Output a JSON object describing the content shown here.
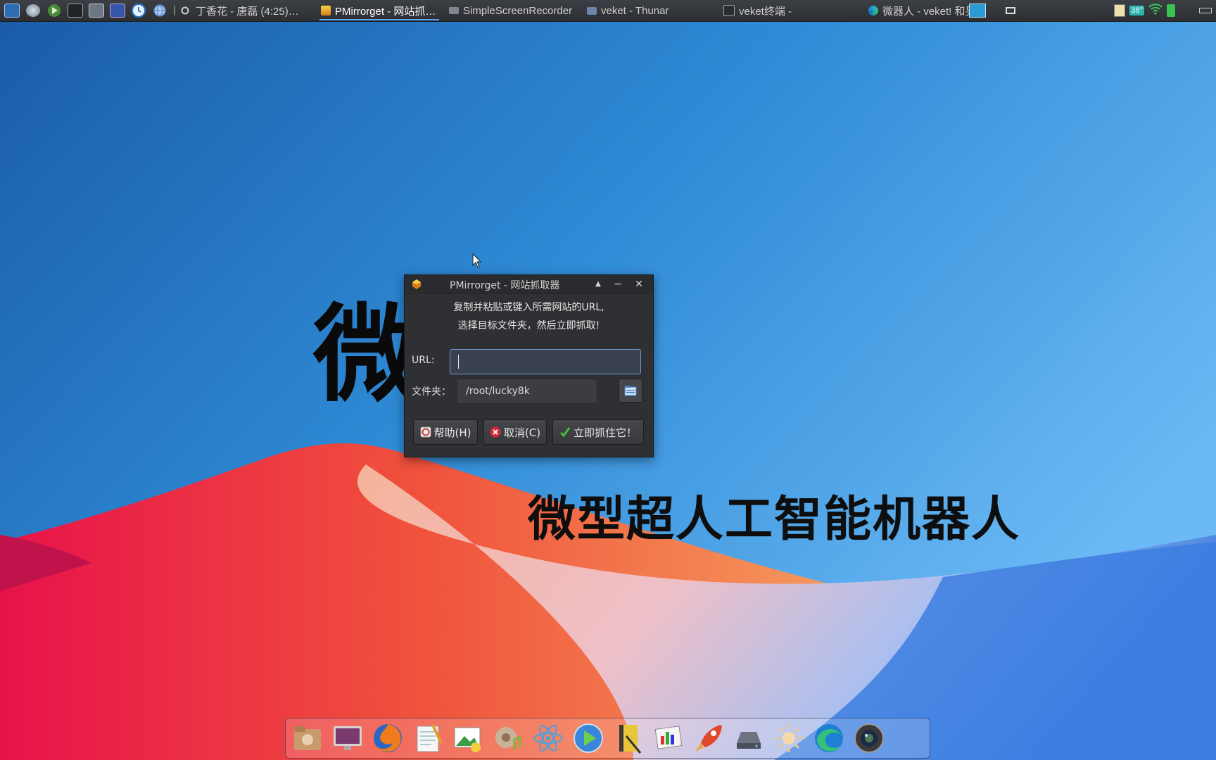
{
  "taskbar": {
    "launchers": [
      "system-monitor-icon",
      "settings-icon",
      "media-player-icon",
      "terminal-icon",
      "screenshot-icon",
      "camera-icon",
      "clock-icon",
      "network-icon"
    ],
    "tasks": [
      {
        "label": "丁香花 - 唐磊 (4:25)…",
        "icon": "music-icon",
        "active": false
      },
      {
        "label": "PMirrorget - 网站抓…",
        "icon": "pmirrorget-icon",
        "active": true
      },
      {
        "label": "SimpleScreenRecorder",
        "icon": "recorder-icon",
        "active": false
      },
      {
        "label": "veket - Thunar",
        "icon": "folder-icon",
        "active": false
      },
      {
        "label": "veket终端 -",
        "icon": "terminal-icon",
        "active": false
      },
      {
        "label": "微器人 - veket! 和另…",
        "icon": "edge-icon",
        "active": false
      }
    ],
    "tray": {
      "temperature": "38°"
    }
  },
  "wallpaper": {
    "big_char": "微",
    "slogan": "微型超人工智能机器人"
  },
  "dialog": {
    "title": "PMirrorget - 网站抓取器",
    "intro_line1": "复制并粘贴或键入所需网站的URL,",
    "intro_line2": "选择目标文件夹，然后立即抓取!",
    "url_label": "URL:",
    "url_value": "",
    "folder_label": "文件夹：",
    "folder_value": "/root/lucky8k",
    "help_label": "帮助(H)",
    "cancel_label": "取消(C)",
    "grab_label": "立即抓住它！"
  },
  "dock": {
    "items": [
      "home-folder-icon",
      "display-settings-icon",
      "firefox-icon",
      "text-editor-icon",
      "image-viewer-icon",
      "audio-player-icon",
      "atom-icon",
      "video-player-icon",
      "notebook-icon",
      "office-icon",
      "rocket-icon",
      "drive-icon",
      "brightness-icon",
      "edge-icon",
      "camera-lens-icon"
    ]
  },
  "colors": {
    "accent": "#5aa8ff",
    "dialog_bg": "#2f3033",
    "url_border": "#6f98d6"
  }
}
